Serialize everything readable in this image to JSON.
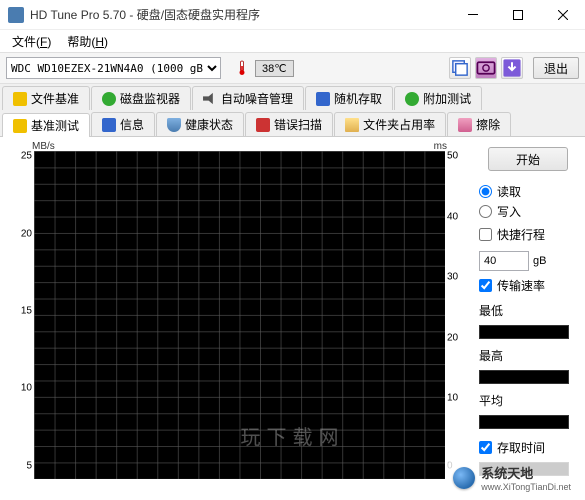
{
  "window": {
    "title": "HD Tune Pro 5.70 - 硬盘/固态硬盘实用程序"
  },
  "menu": {
    "file": "文件(F)",
    "help": "帮助(H)"
  },
  "toolbar": {
    "drive": "WDC WD10EZEX-21WN4A0 (1000 gB)",
    "temperature": "38℃",
    "exit_label": "退出"
  },
  "tabs_row1": [
    {
      "label": "文件基准",
      "icon": "ic-yellow"
    },
    {
      "label": "磁盘监视器",
      "icon": "ic-green"
    },
    {
      "label": "自动噪音管理",
      "icon": "ic-speaker"
    },
    {
      "label": "随机存取",
      "icon": "ic-blue"
    },
    {
      "label": "附加测试",
      "icon": "ic-green"
    }
  ],
  "tabs_row2": [
    {
      "label": "基准测试",
      "icon": "ic-yellow",
      "active": true
    },
    {
      "label": "信息",
      "icon": "ic-blue"
    },
    {
      "label": "健康状态",
      "icon": "ic-shield"
    },
    {
      "label": "错误扫描",
      "icon": "ic-red"
    },
    {
      "label": "文件夹占用率",
      "icon": "ic-folder"
    },
    {
      "label": "擦除",
      "icon": "ic-eraser"
    }
  ],
  "chart_data": {
    "type": "line",
    "title": "",
    "xlabel": "",
    "y_left": {
      "unit": "MB/s",
      "lim": [
        5,
        25
      ],
      "ticks": [
        5,
        10,
        15,
        20,
        25
      ]
    },
    "y_right": {
      "unit": "ms",
      "lim": [
        0,
        50
      ],
      "ticks": [
        0,
        10,
        20,
        30,
        40,
        50
      ]
    },
    "series": [
      {
        "name": "传输速率",
        "values": []
      },
      {
        "name": "存取时间",
        "values": []
      }
    ]
  },
  "side": {
    "start_label": "开始",
    "mode_read": "读取",
    "mode_write": "写入",
    "short_stroke": "快捷行程",
    "stroke_value": "40",
    "stroke_unit": "gB",
    "transfer_rate": "传输速率",
    "min_label": "最低",
    "max_label": "最高",
    "avg_label": "平均",
    "access_time": "存取时间"
  },
  "watermark": {
    "faint": "玩下载网",
    "name": "系统天地",
    "url": "www.XiTongTianDi.net"
  }
}
